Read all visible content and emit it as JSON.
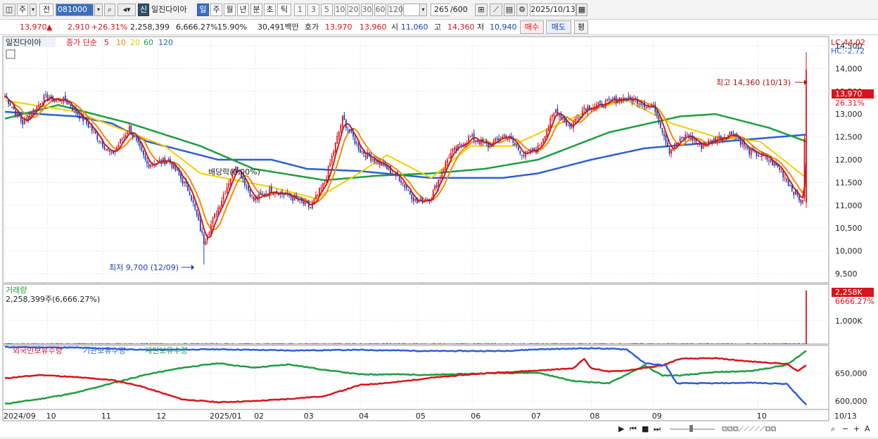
{
  "toolbar": {
    "period_type": "주",
    "prev_label": "전",
    "code": "081000",
    "new_badge": "신",
    "stock_name": "일진다이아",
    "periods": [
      "일",
      "주",
      "월",
      "년",
      "분",
      "초",
      "틱"
    ],
    "intervals": [
      "1",
      "3",
      "5",
      "10",
      "20",
      "30",
      "60",
      "120"
    ],
    "count": "265",
    "count_max": "/600",
    "date": "2025/10/13"
  },
  "quote": {
    "price": "13,970",
    "change_arrow": "▲",
    "change": "2,910",
    "change_pct": "+26.31%",
    "volume": "2,258,399",
    "volume_pct": "6,666.27%",
    "turnover": "15.90%",
    "amount": "30,491백만",
    "hoga_label": "호가",
    "ask": "13,970",
    "bid": "13,960",
    "open_label": "시",
    "open": "11,060",
    "high_label": "고",
    "high": "14,360",
    "low_label": "저",
    "low": "10,940",
    "buy_label": "매수",
    "sell_label": "매도",
    "eval_label": "평"
  },
  "chart_data": {
    "type": "candlestick",
    "legend": {
      "title": "일진다이아",
      "ma_label": "종가 단순",
      "ma_periods": [
        "5",
        "10",
        "20",
        "60",
        "120"
      ],
      "ma_colors": [
        "#d8141c",
        "#f08c00",
        "#f0d000",
        "#1e9e3e",
        "#2d5fd8"
      ]
    },
    "y_ticks": [
      "14,500",
      "14,000",
      "13,500",
      "13,000",
      "12,500",
      "12,000",
      "11,500",
      "11,000",
      "10,500",
      "10,000",
      "9,500"
    ],
    "ylim": [
      9300,
      14700
    ],
    "x_labels": [
      "2024/09",
      "10",
      "11",
      "12",
      "2025/01",
      "02",
      "03",
      "04",
      "05",
      "06",
      "07",
      "08",
      "09",
      "10"
    ],
    "x_right_label": "10/13",
    "lc_label": "LC:44.02",
    "hc_label": "HC:-2.72",
    "current_price_tag": "13,970",
    "current_pct_tag": "26.31%",
    "high_annotation": "최고 14,360 (10/13)",
    "low_annotation": "최저 9,700 (12/09)",
    "event_annotation": "배당락(0.00%)",
    "price_anchors": [
      [
        0,
        13400
      ],
      [
        10,
        12800
      ],
      [
        22,
        13350
      ],
      [
        34,
        13300
      ],
      [
        46,
        12800
      ],
      [
        60,
        12100
      ],
      [
        70,
        12700
      ],
      [
        80,
        11900
      ],
      [
        92,
        12000
      ],
      [
        104,
        11300
      ],
      [
        112,
        10200
      ],
      [
        120,
        10950
      ],
      [
        130,
        11900
      ],
      [
        140,
        11100
      ],
      [
        150,
        11350
      ],
      [
        160,
        11200
      ],
      [
        172,
        10950
      ],
      [
        180,
        11500
      ],
      [
        190,
        12900
      ],
      [
        200,
        12200
      ],
      [
        212,
        11900
      ],
      [
        222,
        11600
      ],
      [
        232,
        11050
      ],
      [
        240,
        11200
      ],
      [
        250,
        12100
      ],
      [
        262,
        12500
      ],
      [
        272,
        12300
      ],
      [
        282,
        12550
      ],
      [
        292,
        12100
      ],
      [
        300,
        12250
      ],
      [
        310,
        13100
      ],
      [
        318,
        12700
      ],
      [
        326,
        13150
      ],
      [
        336,
        13200
      ],
      [
        346,
        13350
      ],
      [
        356,
        13300
      ],
      [
        366,
        13100
      ],
      [
        374,
        12200
      ],
      [
        384,
        12550
      ],
      [
        392,
        12300
      ],
      [
        400,
        12450
      ],
      [
        410,
        12600
      ],
      [
        418,
        12200
      ],
      [
        428,
        12050
      ],
      [
        436,
        11800
      ],
      [
        444,
        11300
      ],
      [
        449,
        11050
      ],
      [
        451,
        13970
      ]
    ],
    "ma_values": {
      "ma20": [
        [
          0,
          13300
        ],
        [
          40,
          13050
        ],
        [
          90,
          12300
        ],
        [
          110,
          11700
        ],
        [
          150,
          11400
        ],
        [
          175,
          11150
        ],
        [
          195,
          11600
        ],
        [
          215,
          12100
        ],
        [
          240,
          11600
        ],
        [
          262,
          12300
        ],
        [
          285,
          12300
        ],
        [
          310,
          12750
        ],
        [
          330,
          13100
        ],
        [
          350,
          13300
        ],
        [
          375,
          12800
        ],
        [
          400,
          12500
        ],
        [
          425,
          12400
        ],
        [
          451,
          11600
        ]
      ],
      "ma60": [
        [
          0,
          12900
        ],
        [
          30,
          13200
        ],
        [
          70,
          12800
        ],
        [
          110,
          12300
        ],
        [
          140,
          11800
        ],
        [
          180,
          11550
        ],
        [
          210,
          11650
        ],
        [
          240,
          11700
        ],
        [
          270,
          11800
        ],
        [
          300,
          12000
        ],
        [
          340,
          12600
        ],
        [
          380,
          12950
        ],
        [
          400,
          13000
        ],
        [
          430,
          12700
        ],
        [
          451,
          12400
        ]
      ],
      "ma120": [
        [
          0,
          13050
        ],
        [
          40,
          12950
        ],
        [
          60,
          12800
        ],
        [
          80,
          12400
        ],
        [
          120,
          12000
        ],
        [
          150,
          12000
        ],
        [
          170,
          11800
        ],
        [
          200,
          11750
        ],
        [
          240,
          11600
        ],
        [
          280,
          11600
        ],
        [
          300,
          11700
        ],
        [
          330,
          12000
        ],
        [
          360,
          12250
        ],
        [
          390,
          12350
        ],
        [
          420,
          12450
        ],
        [
          451,
          12550
        ]
      ]
    },
    "volume_panel": {
      "title": "거래량",
      "summary": "2,258,399주(6,666.27%)",
      "tick": "1,000K",
      "tag_value": "2,258K",
      "tag_pct": "6666.27%",
      "last_volume": 2258399,
      "max": 2400000
    },
    "holdings_panel": {
      "series_names": [
        "외국인보유수량",
        "기관보유수량",
        "개인보유수량"
      ],
      "series_colors": [
        "#d8141c",
        "#2d5fd8",
        "#1e9e3e"
      ],
      "ticks": [
        "650,000",
        "600,000"
      ],
      "ylim": [
        585000,
        700000
      ],
      "foreign": [
        [
          0,
          641000
        ],
        [
          20,
          647000
        ],
        [
          40,
          643000
        ],
        [
          60,
          638000
        ],
        [
          75,
          628000
        ],
        [
          100,
          603000
        ],
        [
          120,
          598000
        ],
        [
          140,
          600000
        ],
        [
          160,
          604000
        ],
        [
          180,
          609000
        ],
        [
          200,
          629000
        ],
        [
          220,
          634000
        ],
        [
          240,
          642000
        ],
        [
          270,
          650000
        ],
        [
          300,
          655000
        ],
        [
          320,
          659000
        ],
        [
          326,
          676000
        ],
        [
          330,
          659000
        ],
        [
          340,
          653000
        ],
        [
          350,
          655000
        ],
        [
          370,
          664000
        ],
        [
          380,
          676000
        ],
        [
          400,
          677000
        ],
        [
          420,
          671000
        ],
        [
          440,
          667000
        ],
        [
          446,
          654000
        ],
        [
          451,
          664000
        ]
      ],
      "institution": [
        [
          0,
          697000
        ],
        [
          40,
          696000
        ],
        [
          80,
          692000
        ],
        [
          120,
          693000
        ],
        [
          160,
          691000
        ],
        [
          200,
          692000
        ],
        [
          240,
          690000
        ],
        [
          280,
          690000
        ],
        [
          300,
          693000
        ],
        [
          330,
          695000
        ],
        [
          350,
          693000
        ],
        [
          360,
          668000
        ],
        [
          372,
          664000
        ],
        [
          378,
          632000
        ],
        [
          400,
          632000
        ],
        [
          420,
          633000
        ],
        [
          440,
          631000
        ],
        [
          451,
          593000
        ]
      ],
      "individual": [
        [
          0,
          595000
        ],
        [
          20,
          604000
        ],
        [
          40,
          615000
        ],
        [
          60,
          632000
        ],
        [
          80,
          648000
        ],
        [
          100,
          660000
        ],
        [
          120,
          668000
        ],
        [
          140,
          660000
        ],
        [
          160,
          666000
        ],
        [
          180,
          656000
        ],
        [
          200,
          648000
        ],
        [
          220,
          648000
        ],
        [
          240,
          647000
        ],
        [
          270,
          650000
        ],
        [
          300,
          651000
        ],
        [
          320,
          636000
        ],
        [
          340,
          632000
        ],
        [
          360,
          664000
        ],
        [
          370,
          646000
        ],
        [
          380,
          646000
        ],
        [
          400,
          652000
        ],
        [
          420,
          654000
        ],
        [
          440,
          665000
        ],
        [
          451,
          690000
        ]
      ]
    }
  }
}
